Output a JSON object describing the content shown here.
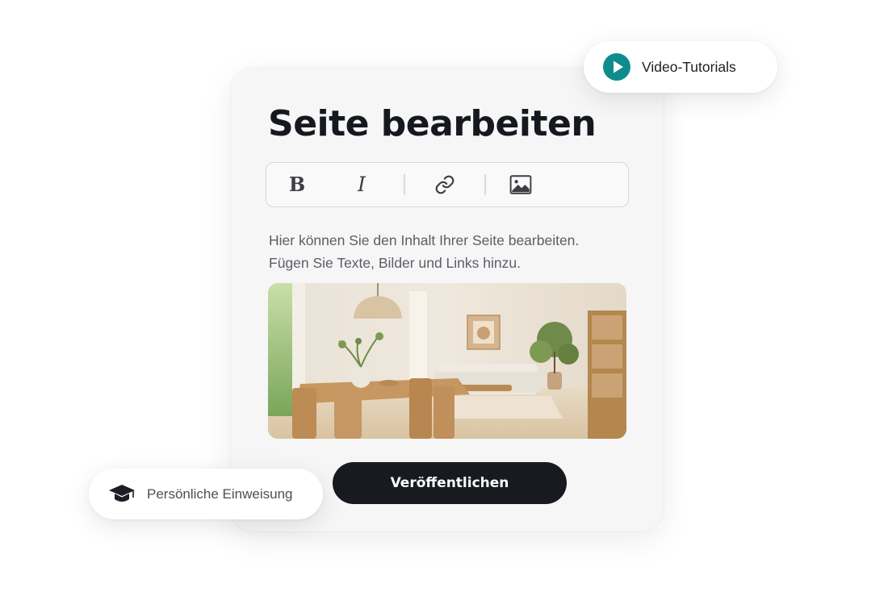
{
  "editor": {
    "title": "Seite bearbeiten",
    "toolbar": {
      "bold_label": "B",
      "italic_label": "I",
      "link_icon": "link-icon",
      "image_icon": "image-icon"
    },
    "body_lines": [
      "Hier können Sie den Inhalt Ihrer Seite bearbeiten.",
      "Fügen Sie Texte, Bilder und Links hinzu."
    ],
    "image": "dining-room-photo",
    "publish_label": "Veröffentlichen"
  },
  "badges": {
    "video": {
      "label": "Video-Tutorials",
      "icon": "play-circle-icon",
      "color": "#0f8b8d"
    },
    "coaching": {
      "label": "Persönliche Einweisung",
      "icon": "graduation-cap-icon"
    }
  },
  "colors": {
    "accent": "#0f8b8d",
    "button": "#181a20",
    "card": "#f6f6f7"
  }
}
